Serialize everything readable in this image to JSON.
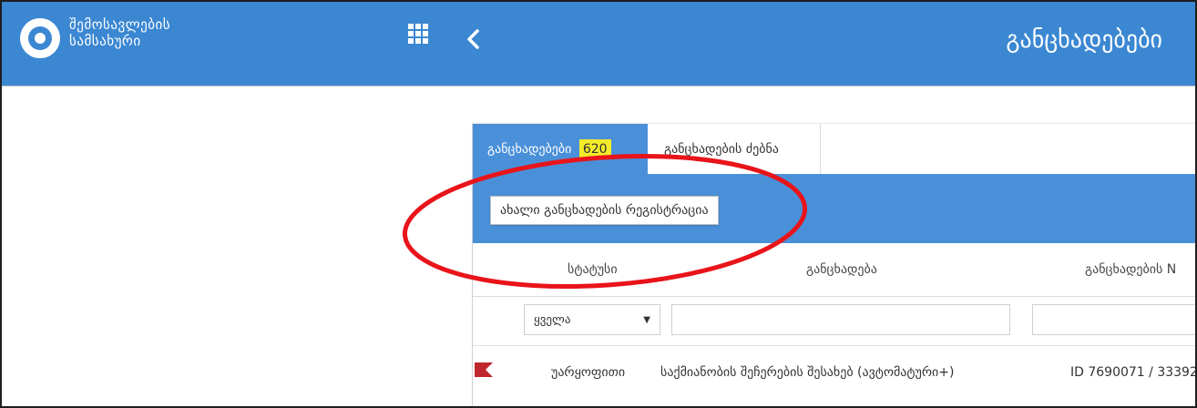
{
  "header": {
    "brand_line1": "შემოსავლების",
    "brand_line2": "სამსახური",
    "page_title": "განცხადებები",
    "bar_color": "#3b87d2",
    "icons": [
      "logo",
      "apps-grid-icon",
      "chevron-left-icon"
    ]
  },
  "tabs": [
    {
      "label": "განცხადებები",
      "badge": "620",
      "active": true
    },
    {
      "label": "განცხადების ძებნა",
      "active": false
    }
  ],
  "actions": {
    "register_label": "ახალი განცხადების რეგისტრაცია"
  },
  "table": {
    "columns": [
      "სტატუსი",
      "განცხადება",
      "განცხადების N"
    ],
    "filters": {
      "status_selected": "ყველა"
    },
    "rows": [
      {
        "status": "უარყოფითი",
        "application": "საქმიანობის შეჩერების შესახებ (ავტომატური+)",
        "number": "ID 7690071 / 33392"
      }
    ]
  },
  "annotation": {
    "shape": "ellipse",
    "color": "#e8141a"
  }
}
